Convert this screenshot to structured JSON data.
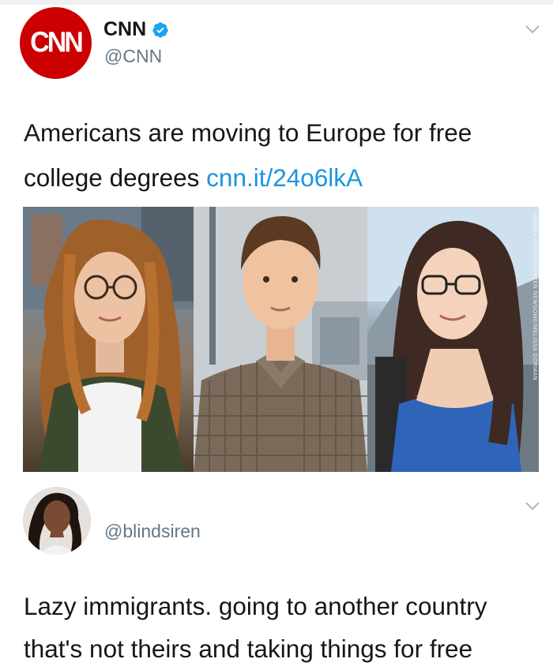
{
  "tweet1": {
    "avatar_logo": "CNN",
    "display_name": "CNN",
    "verified": true,
    "handle": "@CNN",
    "text": "Americans are moving to Europe for free college degrees ",
    "link": "cnn.it/24o6lkA",
    "media": {
      "panels": [
        "woman-with-glasses-photo",
        "young-man-plaid-shirt-photo",
        "woman-mountains-photo"
      ],
      "credit": "HANNAH FEINER/HUNTER NEWSOME/MELISSA GORMAN"
    }
  },
  "tweet2": {
    "handle": "@blindsiren",
    "text_line1": "Lazy immigrants. going to another country",
    "text_line2": "that's not theirs and taking things for free"
  },
  "colors": {
    "cnn_red": "#cc0000",
    "link_blue": "#1b95e0",
    "verified_blue": "#1da1f2",
    "handle_gray": "#657786",
    "text_dark": "#14171a"
  },
  "icons": [
    "verified-badge-icon",
    "chevron-down-icon"
  ]
}
